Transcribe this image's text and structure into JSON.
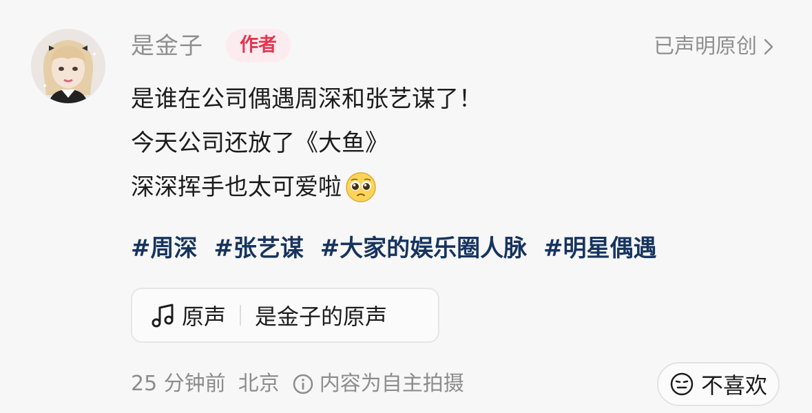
{
  "post": {
    "username": "是金子",
    "author_badge": "作者",
    "original_declaration": "已声明原创",
    "caption_lines": [
      "是谁在公司偶遇周深和张艺谋了！",
      "今天公司还放了《大鱼》",
      "深深挥手也太可爱啦"
    ],
    "caption_emoji": "pleading-face-emoji",
    "hashtags": [
      "#周深",
      "#张艺谋",
      "#大家的娱乐圈人脉",
      "#明星偶遇"
    ],
    "music": {
      "icon": "music-note-icon",
      "label": "原声",
      "name": "是金子的原声"
    },
    "meta": {
      "time": "25 分钟前",
      "location": "北京",
      "info_icon": "info-icon",
      "self_shot": "内容为自主拍摄"
    },
    "dislike": {
      "icon": "neutral-face-icon",
      "label": "不喜欢"
    }
  },
  "colors": {
    "background": "#f7f7f7",
    "author_badge_bg": "#fdecef",
    "author_badge_text": "#e8334d",
    "hashtag": "#17345e",
    "muted": "#8c8c8c"
  }
}
